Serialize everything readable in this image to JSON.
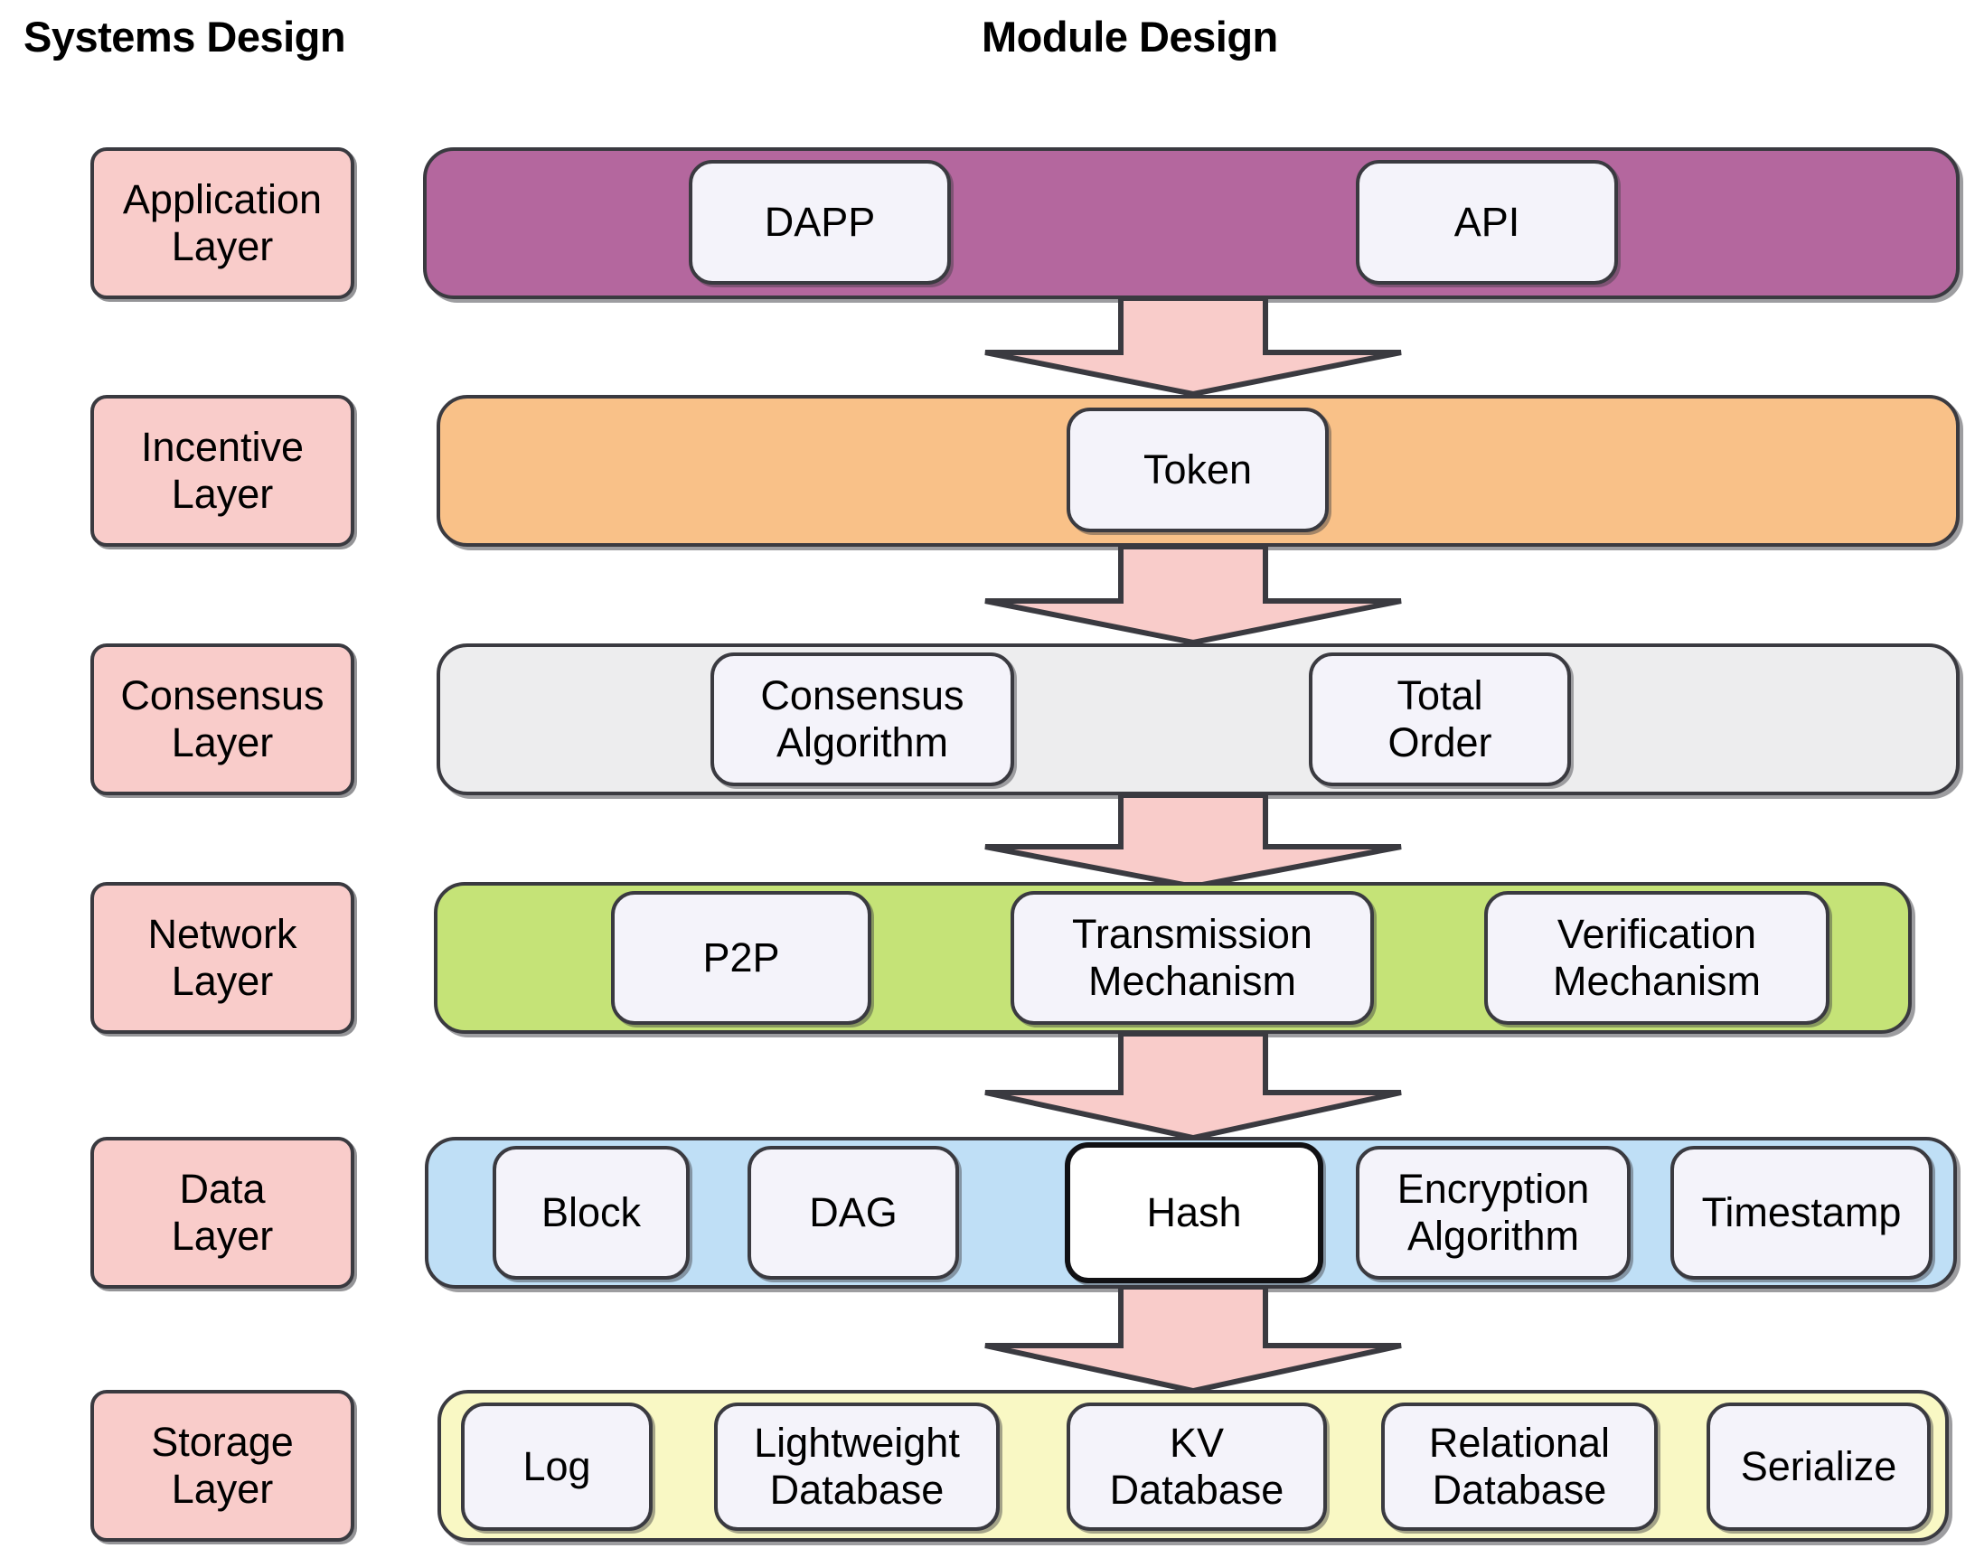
{
  "headings": {
    "left": "Systems Design",
    "right": "Module Design"
  },
  "colors": {
    "layer_chip": "#f9ccca",
    "module_pill": "#f4f3fa",
    "arrow": "#f9ccca",
    "stroke": "#3a3a40",
    "application_band": "#b4679e",
    "incentive_band": "#f9c188",
    "consensus_band": "#ededee",
    "network_band": "#c5e377",
    "data_band": "#bfdff6",
    "storage_band": "#f9f8c4"
  },
  "layers": [
    {
      "id": "application",
      "chip_label": "Application\nLayer",
      "band_color": "#b4679e",
      "modules": [
        {
          "label": "DAPP",
          "emphasis": false
        },
        {
          "label": "API",
          "emphasis": false
        }
      ]
    },
    {
      "id": "incentive",
      "chip_label": "Incentive\nLayer",
      "band_color": "#f9c188",
      "modules": [
        {
          "label": "Token",
          "emphasis": false
        }
      ]
    },
    {
      "id": "consensus",
      "chip_label": "Consensus\nLayer",
      "band_color": "#ededee",
      "modules": [
        {
          "label": "Consensus\nAlgorithm",
          "emphasis": false
        },
        {
          "label": "Total\nOrder",
          "emphasis": false
        }
      ]
    },
    {
      "id": "network",
      "chip_label": "Network\nLayer",
      "band_color": "#c5e377",
      "modules": [
        {
          "label": "P2P",
          "emphasis": false
        },
        {
          "label": "Transmission\nMechanism",
          "emphasis": false
        },
        {
          "label": "Verification\nMechanism",
          "emphasis": false
        }
      ]
    },
    {
      "id": "data",
      "chip_label": "Data\nLayer",
      "band_color": "#bfdff6",
      "modules": [
        {
          "label": "Block",
          "emphasis": false
        },
        {
          "label": "DAG",
          "emphasis": false
        },
        {
          "label": "Hash",
          "emphasis": true
        },
        {
          "label": "Encryption\nAlgorithm",
          "emphasis": false
        },
        {
          "label": "Timestamp",
          "emphasis": false
        }
      ]
    },
    {
      "id": "storage",
      "chip_label": "Storage\nLayer",
      "band_color": "#f9f8c4",
      "modules": [
        {
          "label": "Log",
          "emphasis": false
        },
        {
          "label": "Lightweight\nDatabase",
          "emphasis": false
        },
        {
          "label": "KV\nDatabase",
          "emphasis": false
        },
        {
          "label": "Relational\nDatabase",
          "emphasis": false
        },
        {
          "label": "Serialize",
          "emphasis": false
        }
      ]
    }
  ],
  "arrows": [
    {
      "id": "application-to-incentive",
      "direction": "down"
    },
    {
      "id": "incentive-to-consensus",
      "direction": "down"
    },
    {
      "id": "consensus-to-network",
      "direction": "down"
    },
    {
      "id": "network-to-data",
      "direction": "down"
    },
    {
      "id": "data-to-storage",
      "direction": "down"
    }
  ]
}
